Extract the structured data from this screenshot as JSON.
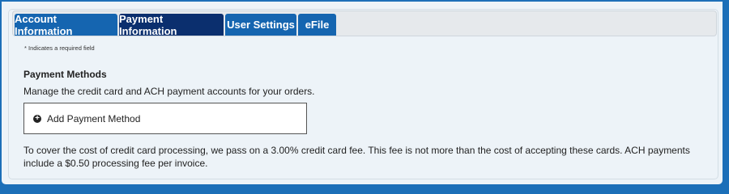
{
  "tabs": [
    {
      "label": "Account Information"
    },
    {
      "label": "Payment Information"
    },
    {
      "label": "User Settings"
    },
    {
      "label": "eFile"
    }
  ],
  "required_note": "* Indicates a required field",
  "payment_methods": {
    "title": "Payment Methods",
    "description": "Manage the credit card and ACH payment accounts for your orders.",
    "add_label": "Add Payment Method",
    "add_icon": "plus-circle-icon"
  },
  "fee_note": "To cover the cost of credit card processing, we pass on a 3.00% credit card fee. This fee is not more than the cost of accepting these cards. ACH payments include a $0.50 processing fee per invoice."
}
